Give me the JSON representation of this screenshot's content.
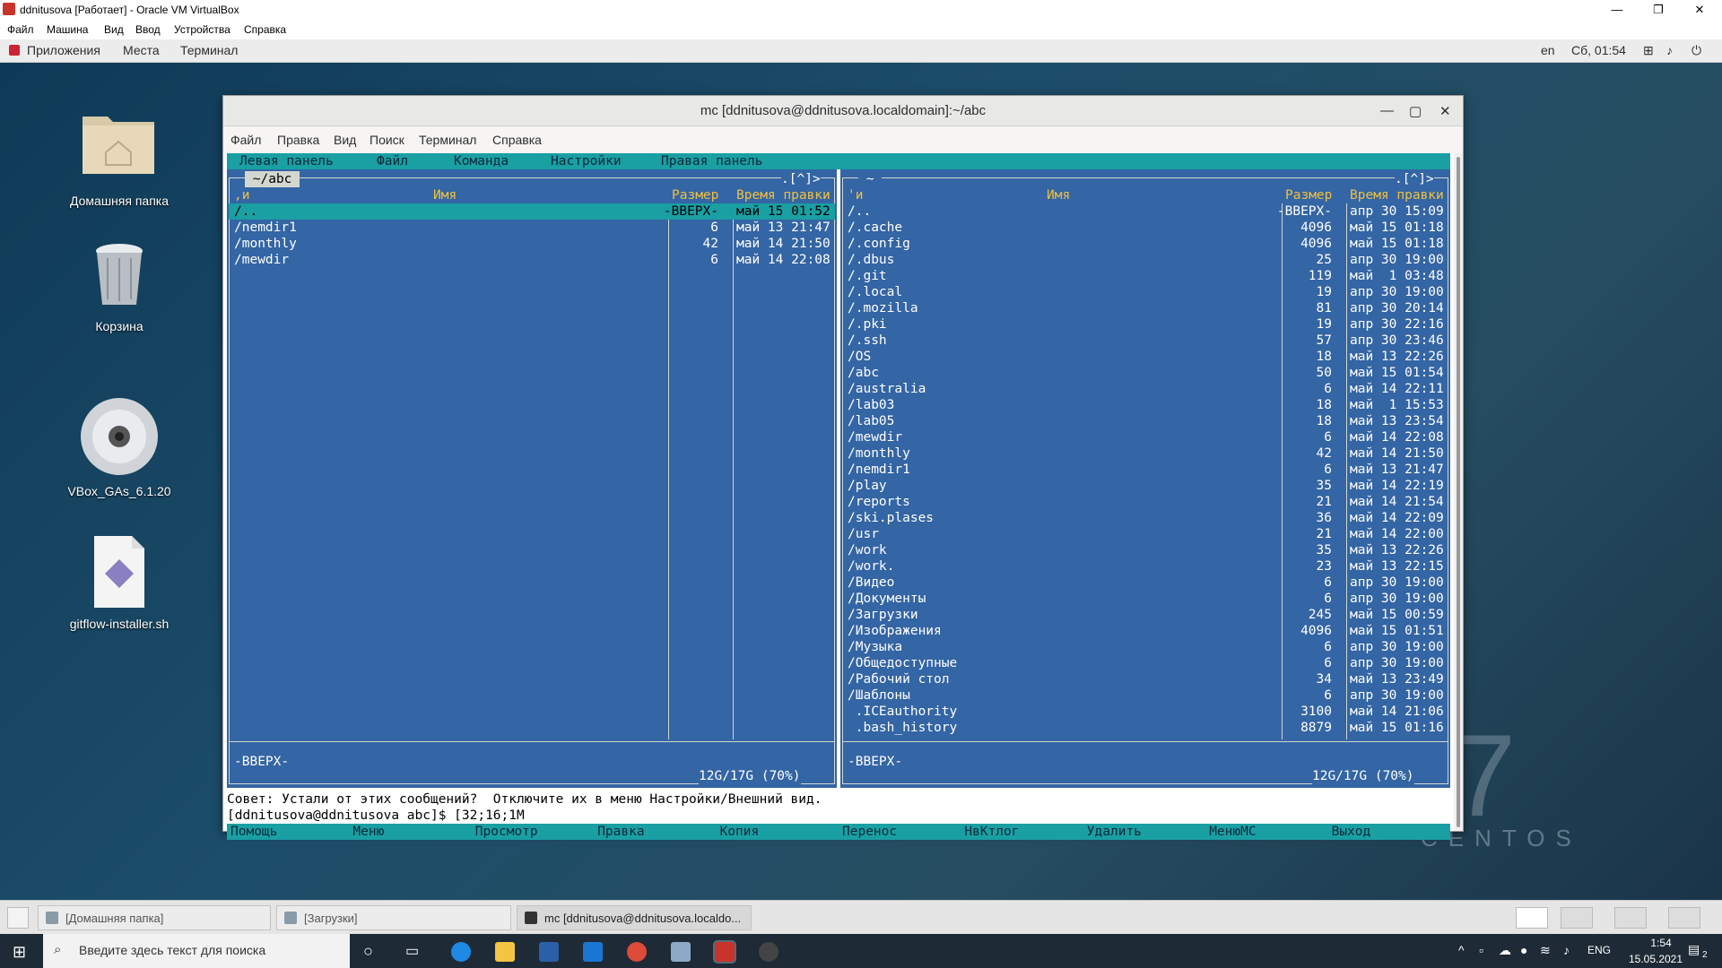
{
  "vbox": {
    "title": "ddnitusova [Работает] - Oracle VM VirtualBox",
    "min": "—",
    "max": "❐",
    "close": "✕",
    "menu": [
      "Файл",
      "Машина",
      "Вид",
      "Ввод",
      "Устройства",
      "Справка"
    ]
  },
  "gnome": {
    "apps": "Приложения",
    "places": "Места",
    "terminal": "Терминал",
    "lang": "en",
    "clock": "Сб, 01:54"
  },
  "desktop": {
    "icons": [
      {
        "label": "Домашняя папка"
      },
      {
        "label": "Корзина"
      },
      {
        "label": "VBox_GAs_6.1.20"
      },
      {
        "label": "gitflow-installer.sh"
      }
    ],
    "centos_text": "CENTOS",
    "centos_seven": "7"
  },
  "term": {
    "title": "mc [ddnitusova@ddnitusova.localdomain]:~/abc",
    "min": "—",
    "max": "▢",
    "close": "✕",
    "menu": [
      "Файл",
      "Правка",
      "Вид",
      "Поиск",
      "Терминал",
      "Справка"
    ]
  },
  "mc": {
    "menubar": [
      "Левая панель",
      "Файл",
      "Команда",
      "Настройки",
      "Правая панель"
    ],
    "left": {
      "path": " ~/abc ",
      "corner": ".[^]>",
      "header": {
        "sort": ",и",
        "name": "Имя",
        "size": "Размер",
        "time": "Время правки"
      },
      "rows": [
        {
          "name": "/..",
          "size": "-ВВЕРХ-",
          "time": "май 15 01:52"
        },
        {
          "name": "/nemdir1",
          "size": "6",
          "time": "май 13 21:47"
        },
        {
          "name": "/monthly",
          "size": "42",
          "time": "май 14 21:50"
        },
        {
          "name": "/mewdir",
          "size": "6",
          "time": "май 14 22:08"
        }
      ],
      "status": "-ВВЕРХ-",
      "disk": "12G/17G (70%)"
    },
    "right": {
      "path": " ~ ",
      "corner": ".[^]>",
      "header": {
        "sort": "'и",
        "name": "Имя",
        "size": "Размер",
        "time": "Время правки"
      },
      "rows": [
        {
          "name": "/..",
          "size": "-ВВЕРХ-",
          "time": "апр 30 15:09"
        },
        {
          "name": "/.cache",
          "size": "4096",
          "time": "май 15 01:18"
        },
        {
          "name": "/.config",
          "size": "4096",
          "time": "май 15 01:18"
        },
        {
          "name": "/.dbus",
          "size": "25",
          "time": "апр 30 19:00"
        },
        {
          "name": "/.git",
          "size": "119",
          "time": "май  1 03:48"
        },
        {
          "name": "/.local",
          "size": "19",
          "time": "апр 30 19:00"
        },
        {
          "name": "/.mozilla",
          "size": "81",
          "time": "апр 30 20:14"
        },
        {
          "name": "/.pki",
          "size": "19",
          "time": "апр 30 22:16"
        },
        {
          "name": "/.ssh",
          "size": "57",
          "time": "апр 30 23:46"
        },
        {
          "name": "/OS",
          "size": "18",
          "time": "май 13 22:26"
        },
        {
          "name": "/abc",
          "size": "50",
          "time": "май 15 01:54"
        },
        {
          "name": "/australia",
          "size": "6",
          "time": "май 14 22:11"
        },
        {
          "name": "/lab03",
          "size": "18",
          "time": "май  1 15:53"
        },
        {
          "name": "/lab05",
          "size": "18",
          "time": "май 13 23:54"
        },
        {
          "name": "/mewdir",
          "size": "6",
          "time": "май 14 22:08"
        },
        {
          "name": "/monthly",
          "size": "42",
          "time": "май 14 21:50"
        },
        {
          "name": "/nemdir1",
          "size": "6",
          "time": "май 13 21:47"
        },
        {
          "name": "/play",
          "size": "35",
          "time": "май 14 22:19"
        },
        {
          "name": "/reports",
          "size": "21",
          "time": "май 14 21:54"
        },
        {
          "name": "/ski.plases",
          "size": "36",
          "time": "май 14 22:09"
        },
        {
          "name": "/usr",
          "size": "21",
          "time": "май 14 22:00"
        },
        {
          "name": "/work",
          "size": "35",
          "time": "май 13 22:26"
        },
        {
          "name": "/work.",
          "size": "23",
          "time": "май 13 22:15"
        },
        {
          "name": "/Видео",
          "size": "6",
          "time": "апр 30 19:00"
        },
        {
          "name": "/Документы",
          "size": "6",
          "time": "апр 30 19:00"
        },
        {
          "name": "/Загрузки",
          "size": "245",
          "time": "май 15 00:59"
        },
        {
          "name": "/Изображения",
          "size": "4096",
          "time": "май 15 01:51"
        },
        {
          "name": "/Музыка",
          "size": "6",
          "time": "апр 30 19:00"
        },
        {
          "name": "/Общедоступные",
          "size": "6",
          "time": "апр 30 19:00"
        },
        {
          "name": "/Рабочий стол",
          "size": "34",
          "time": "май 13 23:49"
        },
        {
          "name": "/Шаблоны",
          "size": "6",
          "time": "апр 30 19:00"
        },
        {
          "name": " .ICEauthority",
          "size": "3100",
          "time": "май 14 21:06"
        },
        {
          "name": " .bash_history",
          "size": "8879",
          "time": "май 15 01:16"
        }
      ],
      "status": "-ВВЕРХ-",
      "disk": "12G/17G (70%)"
    },
    "hint": "Совет: Устали от этих сообщений?  Отключите их в меню Настройки/Внешний вид.",
    "prompt": "[ddnitusova@ddnitusova abc]$ [32;16;1M",
    "fkeys": [
      {
        "n": "1",
        "l": "Помощь"
      },
      {
        "n": "2",
        "l": "Меню"
      },
      {
        "n": "3",
        "l": "Просмотр"
      },
      {
        "n": "4",
        "l": "Правка"
      },
      {
        "n": "5",
        "l": "Копия"
      },
      {
        "n": "6",
        "l": "Перенос"
      },
      {
        "n": "7",
        "l": "НвКтлог"
      },
      {
        "n": "8",
        "l": "Удалить"
      },
      {
        "n": "9",
        "l": "МенюМС"
      },
      {
        "n": "10",
        "l": "Выход"
      }
    ]
  },
  "gnome_tasks": [
    {
      "label": "[Домашняя папка]"
    },
    {
      "label": "[Загрузки]"
    },
    {
      "label": "mc [ddnitusova@ddnitusova.localdo..."
    }
  ],
  "windows": {
    "search_placeholder": "Введите здесь текст для поиска",
    "lang": "ENG",
    "time": "1:54",
    "date": "15.05.2021",
    "notif": "2"
  }
}
